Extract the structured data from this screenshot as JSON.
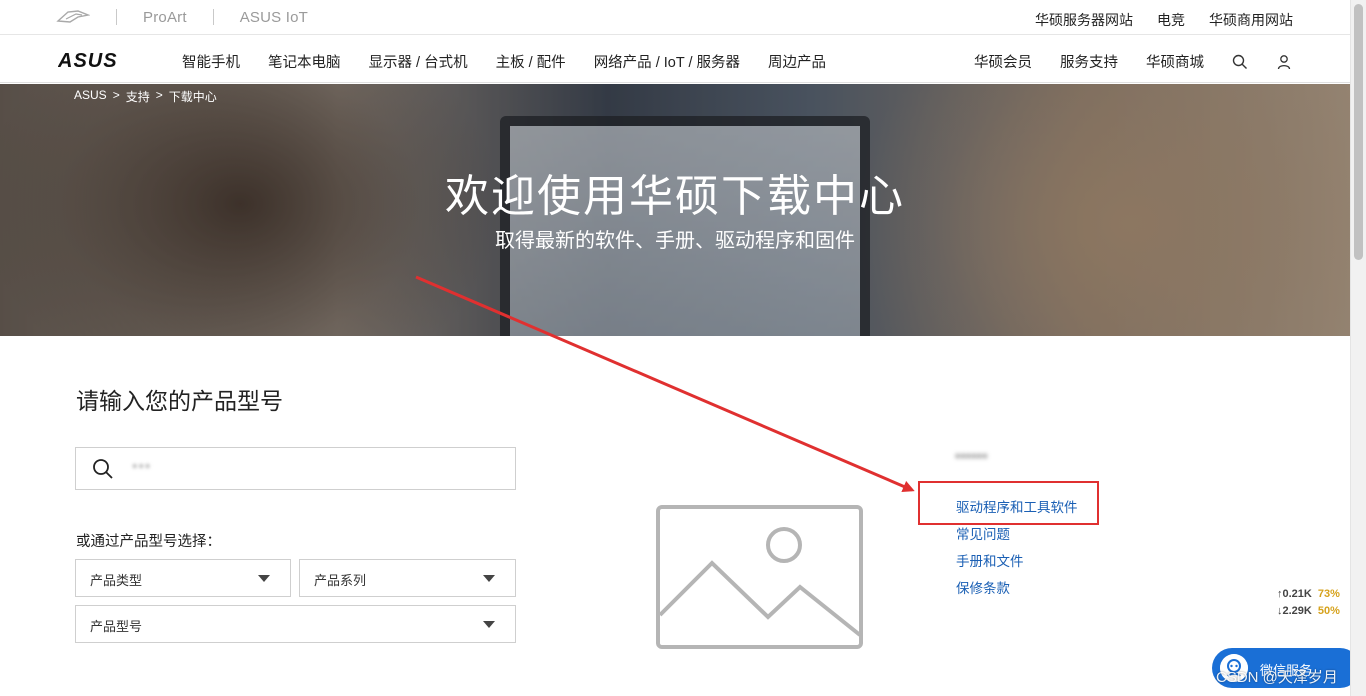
{
  "topbar": {
    "brands": [
      "ProArt",
      "ASUS IoT"
    ],
    "links": [
      "华硕服务器网站",
      "电竞",
      "华硕商用网站"
    ]
  },
  "nav": {
    "logo_alt": "ASUS",
    "menu": [
      "智能手机",
      "笔记本电脑",
      "显示器 / 台式机",
      "主板 / 配件",
      "网络产品 / IoT / 服务器",
      "周边产品"
    ],
    "right": [
      "华硕会员",
      "服务支持",
      "华硕商城"
    ],
    "icons": [
      "search-icon",
      "user-icon"
    ]
  },
  "hero": {
    "breadcrumb": [
      "ASUS",
      ">",
      "支持",
      ">",
      "下载中心"
    ],
    "title": "欢迎使用华硕下载中心",
    "subtitle": "取得最新的软件、手册、驱动程序和固件"
  },
  "search": {
    "prompt": "请输入您的产品型号",
    "value": "***"
  },
  "selectors": {
    "label": "或通过产品型号选择：",
    "type": "产品类型",
    "series": "产品系列",
    "model": "产品型号"
  },
  "product": {
    "name": "******",
    "links": [
      "驱动程序和工具软件",
      "常见问题",
      "手册和文件",
      "保修条款"
    ],
    "highlighted_link": "驱动程序和工具软件"
  },
  "overlay": {
    "net_up": "↑0.21K",
    "net_up_pct": "73%",
    "net_down": "↓2.29K",
    "net_down_pct": "50%",
    "chat_label": "微信服务",
    "watermark": "CSDN @天泽岁月",
    "annotation_color": "#e03030"
  },
  "colors": {
    "link": "#1a5fb4",
    "chat": "#1a6fd6"
  }
}
